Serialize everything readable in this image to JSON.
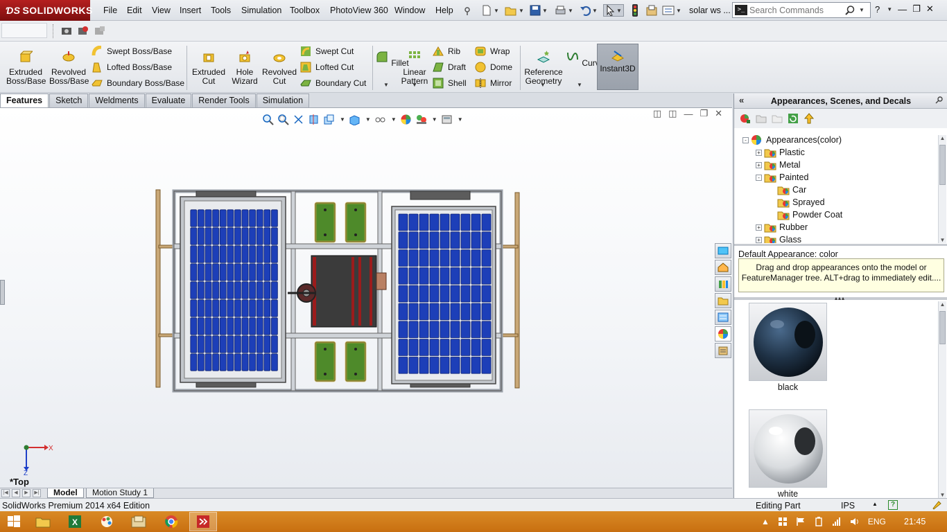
{
  "app": {
    "logo_text": "SOLIDWORKS",
    "document_title": "solar ws ..."
  },
  "menu": [
    "File",
    "Edit",
    "View",
    "Insert",
    "Tools",
    "Simulation",
    "Toolbox",
    "PhotoView 360",
    "Window",
    "Help"
  ],
  "search": {
    "placeholder": "Search Commands"
  },
  "command_manager": {
    "extruded_boss": "Extruded Boss/Base",
    "revolved_boss": "Revolved Boss/Base",
    "swept_boss": "Swept Boss/Base",
    "lofted_boss": "Lofted Boss/Base",
    "boundary_boss": "Boundary Boss/Base",
    "extruded_cut": "Extruded Cut",
    "hole_wizard": "Hole Wizard",
    "revolved_cut": "Revolved Cut",
    "swept_cut": "Swept Cut",
    "lofted_cut": "Lofted Cut",
    "boundary_cut": "Boundary Cut",
    "fillet": "Fillet",
    "linear_pattern": "Linear Pattern",
    "rib": "Rib",
    "draft": "Draft",
    "shell": "Shell",
    "wrap": "Wrap",
    "dome": "Dome",
    "mirror": "Mirror",
    "reference_geometry": "Reference Geometry",
    "curves": "Curves",
    "instant3d": "Instant3D"
  },
  "tabs": [
    "Features",
    "Sketch",
    "Weldments",
    "Evaluate",
    "Render Tools",
    "Simulation"
  ],
  "view": {
    "orientation_label": "*Top",
    "axis_x": "X",
    "axis_z": "Z"
  },
  "bottom_tabs": [
    "Model",
    "Motion Study 1"
  ],
  "task_pane": {
    "title": "Appearances, Scenes, and Decals",
    "tree": [
      {
        "label": "Appearances(color)",
        "level": 0,
        "expander": "-"
      },
      {
        "label": "Plastic",
        "level": 1,
        "expander": "+"
      },
      {
        "label": "Metal",
        "level": 1,
        "expander": "+"
      },
      {
        "label": "Painted",
        "level": 1,
        "expander": "-"
      },
      {
        "label": "Car",
        "level": 2,
        "expander": ""
      },
      {
        "label": "Sprayed",
        "level": 2,
        "expander": ""
      },
      {
        "label": "Powder Coat",
        "level": 2,
        "expander": ""
      },
      {
        "label": "Rubber",
        "level": 1,
        "expander": "+"
      },
      {
        "label": "Glass",
        "level": 1,
        "expander": "+"
      }
    ],
    "default_appearance": "Default Appearance: color",
    "tooltip": "Drag and drop appearances onto the model or FeatureManager tree.  ALT+drag to immediately edit....",
    "swatches": [
      {
        "label": "black",
        "color": "#1f3246"
      },
      {
        "label": "white",
        "color": "#e8eaec"
      }
    ]
  },
  "status": {
    "edition": "SolidWorks Premium 2014 x64 Edition",
    "mode": "Editing Part",
    "units": "IPS"
  },
  "taskbar": {
    "language": "ENG",
    "clock": "21:45"
  },
  "colors": {
    "brand": "#a01818",
    "taskbar": "#d07a1a",
    "solar_cell": "#1d3fb8",
    "mount_green": "#4e8a2a"
  }
}
